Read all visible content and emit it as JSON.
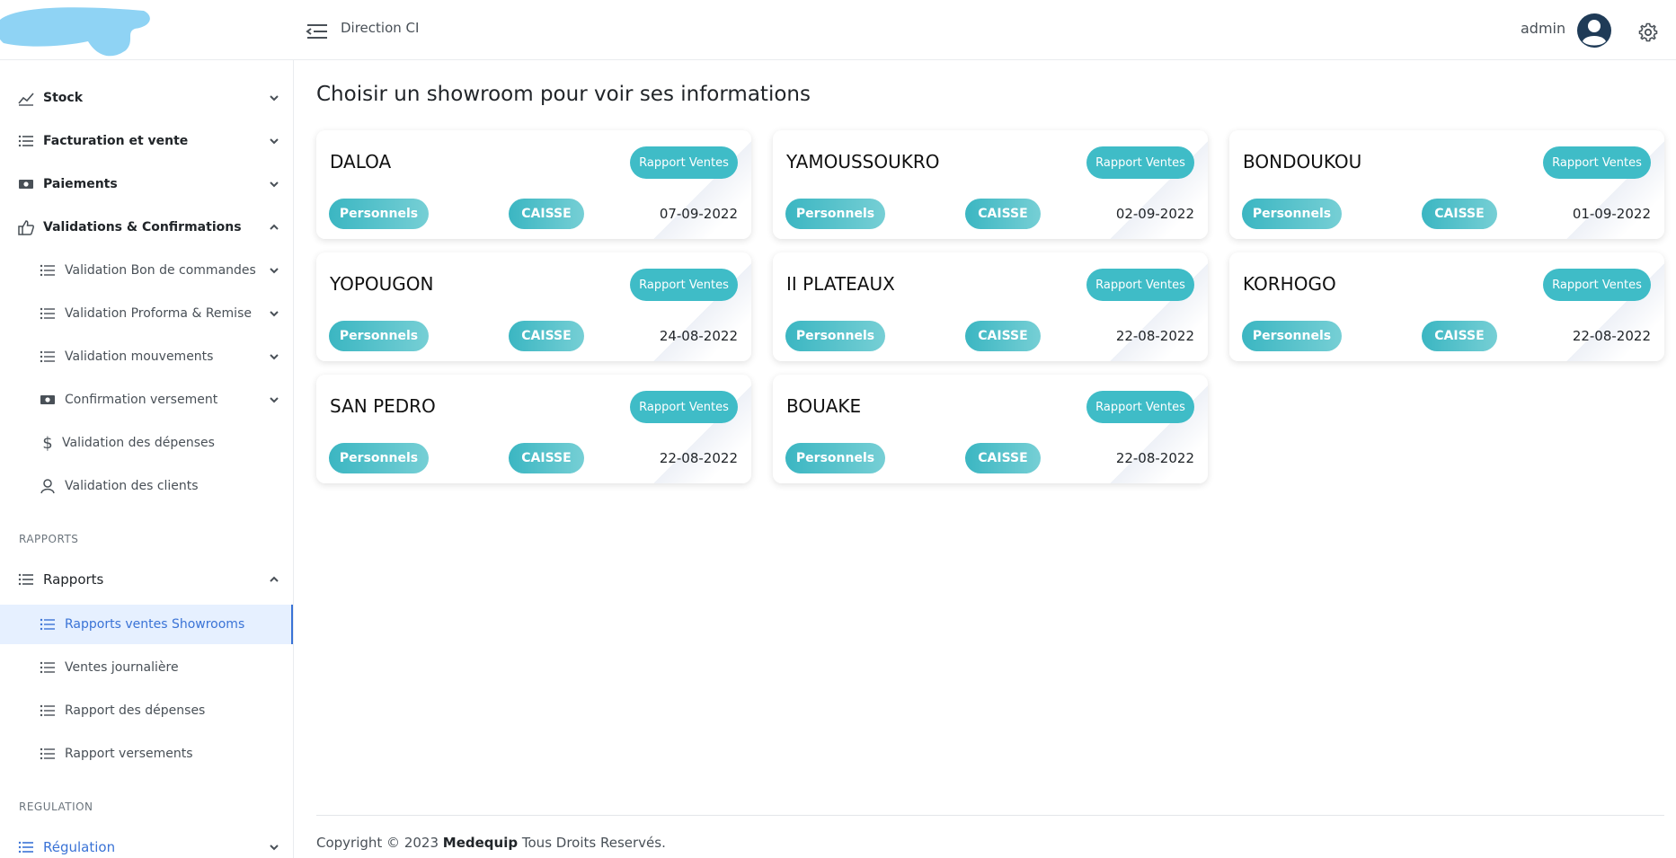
{
  "header": {
    "direction": "Direction CI",
    "user": "admin"
  },
  "sidebar": {
    "items": [
      {
        "label": "Stock"
      },
      {
        "label": "Facturation et vente"
      },
      {
        "label": "Paiements"
      },
      {
        "label": "Validations & Confirmations"
      },
      {
        "label": "Validation Bon de commandes"
      },
      {
        "label": "Validation Proforma & Remise"
      },
      {
        "label": "Validation mouvements"
      },
      {
        "label": "Confirmation versement"
      },
      {
        "label": "Validation des dépenses"
      },
      {
        "label": "Validation des clients"
      },
      {
        "label": "Rapports"
      },
      {
        "label": "Rapports ventes Showrooms"
      },
      {
        "label": "Ventes journalière"
      },
      {
        "label": "Rapport des dépenses"
      },
      {
        "label": "Rapport versements"
      },
      {
        "label": "Régulation"
      }
    ],
    "sections": {
      "rapports": "RAPPORTS",
      "regulation": "REGULATION"
    }
  },
  "main": {
    "title": "Choisir un showroom pour voir ses informations",
    "rapport_label": "Rapport Ventes",
    "personnels_label": "Personnels",
    "caisse_label": "CAISSE",
    "showrooms": [
      {
        "name": "DALOA",
        "date": "07-09-2022"
      },
      {
        "name": "YAMOUSSOUKRO",
        "date": "02-09-2022"
      },
      {
        "name": "BONDOUKOU",
        "date": "01-09-2022"
      },
      {
        "name": "YOPOUGON",
        "date": "24-08-2022"
      },
      {
        "name": "II PLATEAUX",
        "date": "22-08-2022"
      },
      {
        "name": "KORHOGO",
        "date": "22-08-2022"
      },
      {
        "name": "SAN PEDRO",
        "date": "22-08-2022"
      },
      {
        "name": "BOUAKE",
        "date": "22-08-2022"
      }
    ]
  },
  "footer": {
    "prefix": "Copyright © 2023",
    "brand": "Medequip",
    "suffix": "Tous Droits Reservés."
  },
  "colors": {
    "accent": "#3fbcc7",
    "active": "#3a73d6",
    "logo": "#8fd3f4"
  }
}
